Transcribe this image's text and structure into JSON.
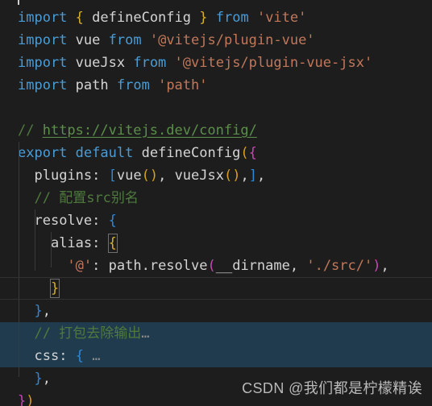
{
  "editor": {
    "background": "#1d1d1d",
    "selection_color": "#1f3b4d",
    "cursor_line_border": "#313131",
    "indent_guide_color": "#3a3a3a",
    "filetype": "javascript",
    "language_hint": "vite.config.js"
  },
  "colors": {
    "keyword": "#4a9cd6",
    "identifier": "#d4d4d4",
    "string": "#c1785a",
    "comment": "#4f7a3e",
    "link": "#5c8f4a",
    "bracket_blue": "#2f88d6",
    "bracket_yellow": "#d8b029",
    "bracket_magenta": "#c746b5",
    "bracket_orange": "#d8a01b",
    "watermark": "#b9b9b9"
  },
  "code": {
    "line1": {
      "kw_import": "import",
      "brace_open": "{",
      "name": "defineConfig",
      "brace_close": "}",
      "kw_from": "from",
      "module": "'vite'"
    },
    "line2": {
      "kw_import": "import",
      "name": "vue",
      "kw_from": "from",
      "module": "'@vitejs/plugin-vue'"
    },
    "line3": {
      "kw_import": "import",
      "name": "vueJsx",
      "kw_from": "from",
      "module": "'@vitejs/plugin-vue-jsx'"
    },
    "line4": {
      "kw_import": "import",
      "name": "path",
      "kw_from": "from",
      "module": "'path'"
    },
    "line6": {
      "slashes": "// ",
      "url": "https://vitejs.dev/config/"
    },
    "line7": {
      "kw_export": "export",
      "kw_default": "default",
      "fn": "defineConfig",
      "paren": "(",
      "brace": "{"
    },
    "line8": {
      "prop": "plugins",
      "colon": ": ",
      "bracket_open": "[",
      "plugin1": "vue",
      "call1": "()",
      "sep": ", ",
      "plugin2": "vueJsx",
      "call2": "()",
      "comma1": ",",
      "bracket_close": "]",
      "comma2": ","
    },
    "line9": {
      "slashes": "// ",
      "text": "配置src别名"
    },
    "line10": {
      "prop": "resolve",
      "colon": ": ",
      "brace": "{"
    },
    "line11": {
      "prop": "alias",
      "colon": ": ",
      "brace": "{"
    },
    "line12": {
      "key": "'@'",
      "colon": ": ",
      "obj": "path",
      "dot": ".",
      "method": "resolve",
      "paren_open": "(",
      "arg1": "__dirname",
      "sep": ", ",
      "arg2": "'./src/'",
      "paren_close": ")",
      "comma": ","
    },
    "line13": {
      "brace": "}"
    },
    "line14": {
      "brace": "}",
      "comma": ","
    },
    "line15": {
      "slashes": "// ",
      "text": "打包去除输出",
      "fold": "…"
    },
    "line16": {
      "prop": "css",
      "colon": ": ",
      "brace": "{",
      "fold": "…"
    },
    "line17": {
      "brace": "}",
      "comma": ","
    },
    "line18": {
      "brace": "}",
      "paren": ")"
    }
  },
  "watermark": {
    "text": "CSDN @我们都是柠檬精诶"
  }
}
